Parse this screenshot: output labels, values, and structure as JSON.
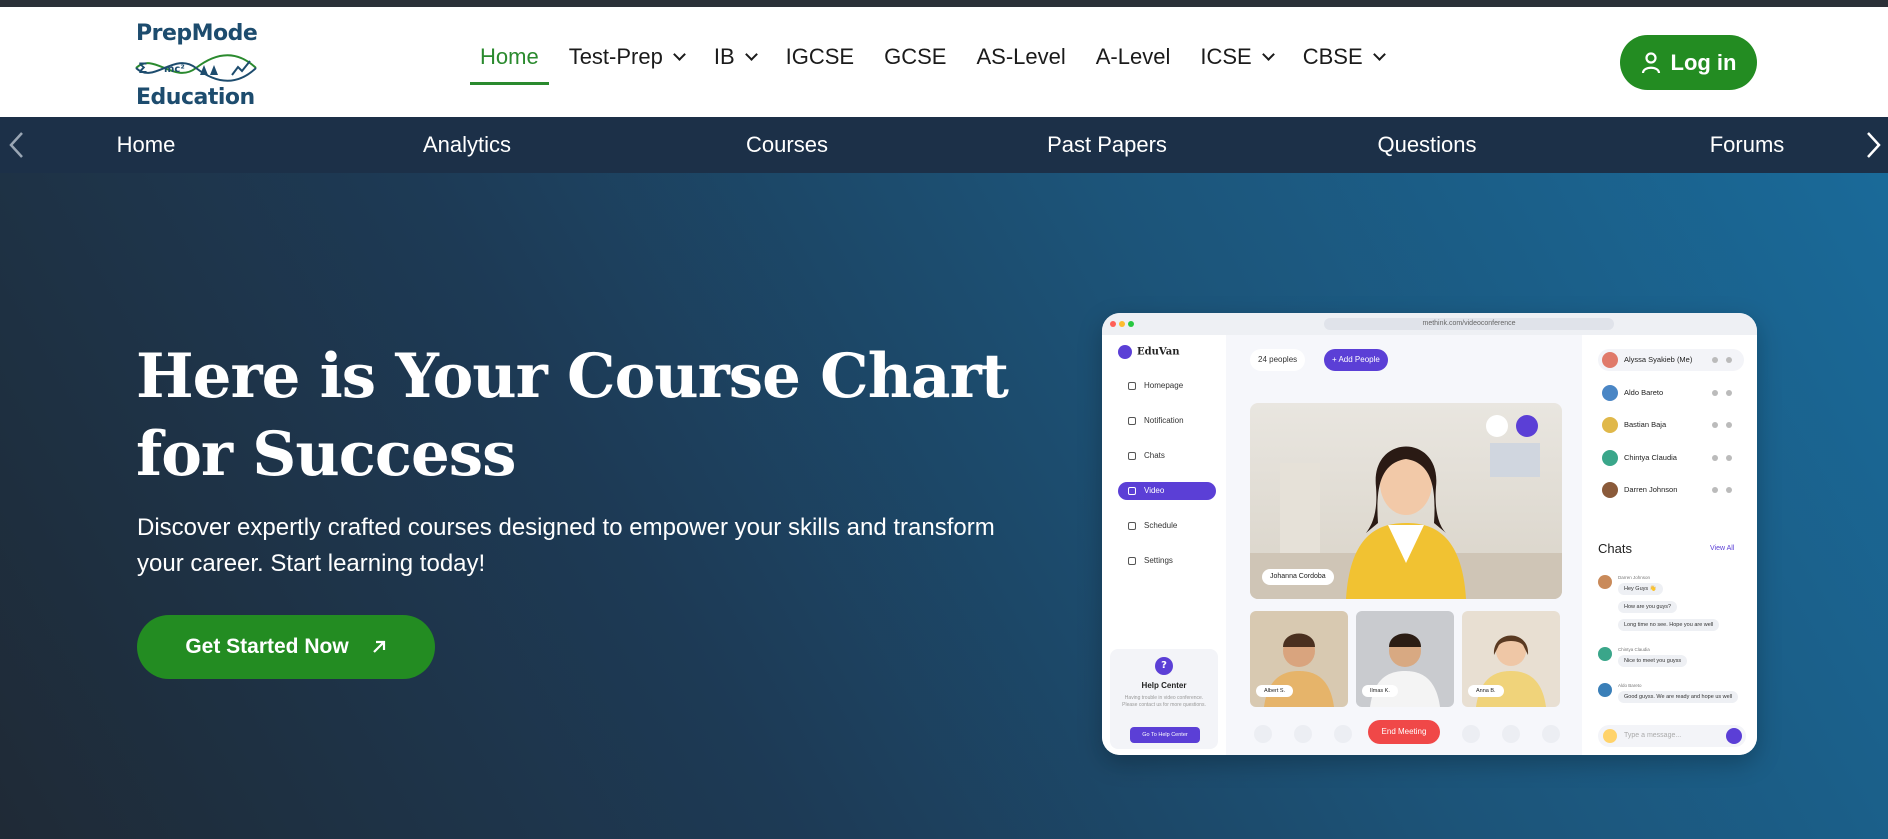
{
  "header": {
    "logo": {
      "line1": "PrepMode",
      "line2": "Education"
    },
    "nav": [
      {
        "label": "Home",
        "active": true,
        "dropdown": false
      },
      {
        "label": "Test-Prep",
        "active": false,
        "dropdown": true
      },
      {
        "label": "IB",
        "active": false,
        "dropdown": true
      },
      {
        "label": "IGCSE",
        "active": false,
        "dropdown": false
      },
      {
        "label": "GCSE",
        "active": false,
        "dropdown": false
      },
      {
        "label": "AS-Level",
        "active": false,
        "dropdown": false
      },
      {
        "label": "A-Level",
        "active": false,
        "dropdown": false
      },
      {
        "label": "ICSE",
        "active": false,
        "dropdown": true
      },
      {
        "label": "CBSE",
        "active": false,
        "dropdown": true
      }
    ],
    "login_label": "Log in"
  },
  "subnav": {
    "items": [
      "Home",
      "Analytics",
      "Courses",
      "Past Papers",
      "Questions",
      "Forums"
    ]
  },
  "hero": {
    "title": "Here is Your Course Chart for Success",
    "subtitle": "Discover expertly crafted courses designed to empower your skills and transform your career. Start learning today!",
    "cta_label": "Get Started Now"
  },
  "mockup": {
    "url": "methink.com/videoconference",
    "brand": "EduVan",
    "sidebar": [
      "Homepage",
      "Notification",
      "Chats",
      "Video",
      "Schedule",
      "Settings"
    ],
    "active_sidebar": "Video",
    "help": {
      "title": "Help Center",
      "desc": "Having trouble in video conference. Please contact us for more questions.",
      "button": "Go To Help Center"
    },
    "people_count": "24 peoples",
    "add_people": "+ Add People",
    "main_speaker": "Johanna Cordoba",
    "thumbs": [
      "Albert S.",
      "Ilmas K.",
      "Anna B."
    ],
    "end_meeting": "End Meeting",
    "participants": [
      "Alyssa Syakieb (Me)",
      "Aldo Bareto",
      "Bastian Baja",
      "Chintya Claudia",
      "Darren Johnson"
    ],
    "chats_title": "Chats",
    "view_all": "View All",
    "chat": [
      {
        "name": "Darren Johnson",
        "messages": [
          "Hey Guys 👋",
          "How are you guys?",
          "Long time no see. Hope you are well"
        ]
      },
      {
        "name": "Chintya Claudia",
        "messages": [
          "Nice to meet you guyss"
        ]
      },
      {
        "name": "Aldo Bareto",
        "messages": [
          "Good guyss. We are ready and hope us well"
        ]
      }
    ],
    "type_placeholder": "Type a message..."
  },
  "colors": {
    "brand_green": "#238c22",
    "nav_active": "#2a8a2e",
    "subnav_bg": "#1c3048",
    "logo_blue": "#1d4c6e",
    "mock_accent": "#5b3fd6"
  }
}
